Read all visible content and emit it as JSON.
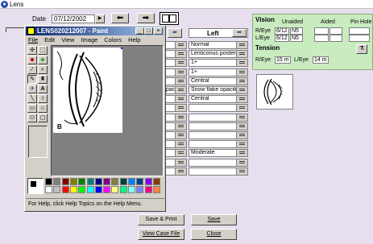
{
  "window": {
    "title": "Lens"
  },
  "date": {
    "label": "Date",
    "value": "07/12/2002"
  },
  "column_header": {
    "left_label": "Left"
  },
  "left_column": {
    "rows": [
      "Normal",
      "Lenticonus posterior",
      "1+",
      "1+",
      "Central",
      "Snow flake opacities",
      "Central",
      "",
      "",
      "",
      "",
      "",
      "Moderate",
      "",
      ""
    ]
  },
  "middle_column_partial": [
    "opacities"
  ],
  "paint": {
    "title": "LENS020212007 - Paint",
    "menu": [
      "File",
      "Edit",
      "View",
      "Image",
      "Colors",
      "Help"
    ],
    "status": "For Help, click Help Topics on the Help Menu.",
    "canvas_label": "B",
    "palette": [
      "#000000",
      "#808080",
      "#800000",
      "#808000",
      "#008000",
      "#008080",
      "#000080",
      "#800080",
      "#808040",
      "#004040",
      "#0080ff",
      "#004080",
      "#8000ff",
      "#804000",
      "#ffffff",
      "#c0c0c0",
      "#ff0000",
      "#ffff00",
      "#00ff00",
      "#00ffff",
      "#0000ff",
      "#ff00ff",
      "#ffff80",
      "#00ff80",
      "#80ffff",
      "#8080ff",
      "#ff0080",
      "#ff8040"
    ]
  },
  "vision": {
    "title": "Vision",
    "col_unaided": "Unaided",
    "col_aided": "Aided",
    "col_pinhole": "Pin Hole",
    "reye_label": "R/Eye",
    "leye_label": "L/Eye",
    "reye_unaided_1": "6/12",
    "reye_unaided_2": "N5",
    "leye_unaided_1": "6/12",
    "leye_unaided_2": "N5"
  },
  "tension": {
    "title": "Tension",
    "reye_label": "R/Eye",
    "reye_value": "15 m",
    "leye_label": "L/Eye",
    "leye_value": "14 m"
  },
  "buttons": {
    "save_print": "Save & Print",
    "save": "Save",
    "view_case_file": "View Case File",
    "close": "Close"
  }
}
